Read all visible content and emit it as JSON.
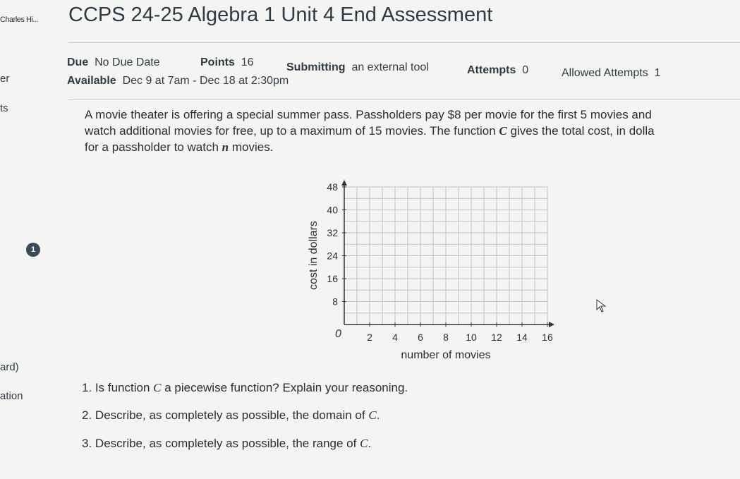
{
  "sidebar": {
    "user": "Charles Hi...",
    "fragments": [
      "er",
      "ts",
      "ard)",
      "ation"
    ],
    "question_badge": "1"
  },
  "header": {
    "title": "CCPS 24-25 Algebra 1 Unit 4 End Assessment"
  },
  "details": {
    "due_label": "Due",
    "due_value": "No Due Date",
    "points_label": "Points",
    "points_value": "16",
    "submitting_label": "Submitting",
    "submitting_value": "an external tool",
    "attempts_label": "Attempts",
    "attempts_value": "0",
    "allowed_label": "Allowed Attempts",
    "allowed_value": "1",
    "available_label": "Available",
    "available_value": "Dec 9 at 7am - Dec 18 at 2:30pm"
  },
  "problem": {
    "line1": "A movie theater is offering a special summer pass. Passholders pay $8 per movie for the first 5 movies and",
    "line2_a": "watch additional movies for free, up to a maximum of 15 movies. The function ",
    "line2_var": "C",
    "line2_b": " gives the total cost, in dolla",
    "line3_a": "for a passholder to watch ",
    "line3_var": "n",
    "line3_b": " movies."
  },
  "chart_data": {
    "type": "line",
    "title": "",
    "xlabel": "number of movies",
    "ylabel": "cost in dollars",
    "x_ticks": [
      "2",
      "4",
      "6",
      "8",
      "10",
      "12",
      "14",
      "16"
    ],
    "y_ticks": [
      "8",
      "16",
      "24",
      "32",
      "40",
      "48"
    ],
    "origin_label": "0",
    "xlim": [
      0,
      16
    ],
    "ylim": [
      0,
      48
    ],
    "grid": true,
    "series": []
  },
  "questions": [
    {
      "num": "1.",
      "a": "Is function ",
      "var": "C",
      "b": " a piecewise function? Explain your reasoning."
    },
    {
      "num": "2.",
      "a": "Describe, as completely as possible, the domain of ",
      "var": "C",
      "b": "."
    },
    {
      "num": "3.",
      "a": "Describe, as completely as possible, the range of ",
      "var": "C",
      "b": "."
    }
  ]
}
